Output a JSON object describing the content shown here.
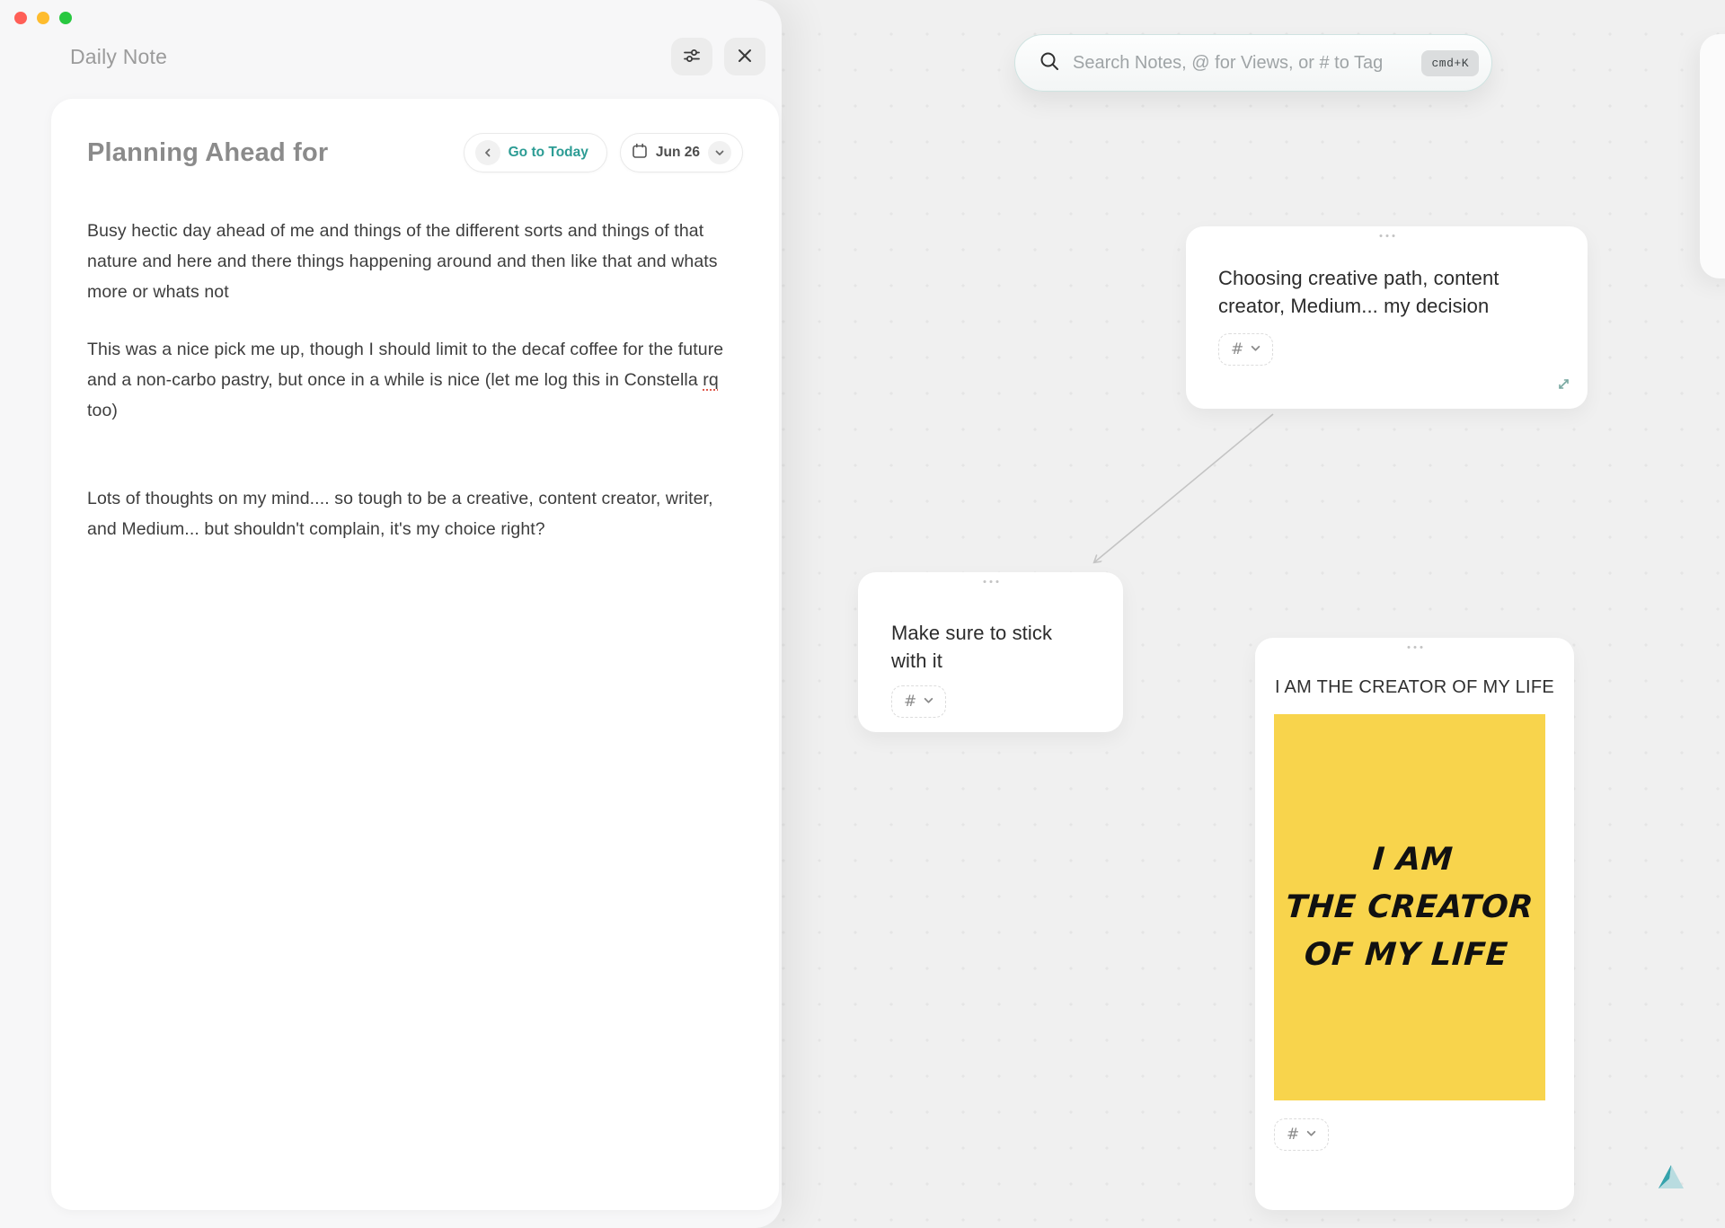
{
  "window": {
    "title": "Daily Note",
    "note": {
      "title": "Planning Ahead for",
      "nav": {
        "go_to_today": "Go to Today",
        "date": "Jun 26"
      },
      "paragraph_1": "Busy hectic day ahead of me and things of the different sorts and things of that nature and here and there things happening around and then like that and whats more or whats not",
      "paragraph_2_before": "This was a nice pick me up, though I should limit to the decaf coffee for the future and a non-carbo pastry, but once in a while is nice (let me log this in Constella ",
      "paragraph_2_misspelled": "rq",
      "paragraph_2_after": " too)",
      "paragraph_3": "Lots of thoughts on my mind.... so tough to be a creative, content creator, writer, and Medium... but shouldn't complain, it's my choice right?"
    }
  },
  "search": {
    "placeholder": "Search Notes, @ for Views, or # to Tag",
    "shortcut": "cmd+K"
  },
  "canvas": {
    "card_choosing": {
      "text": "Choosing creative path, content creator, Medium... my decision",
      "tag": "#"
    },
    "card_stick": {
      "text": "Make sure to stick with it",
      "tag": "#"
    },
    "card_creator": {
      "title": "I AM THE CREATOR OF MY LIFE",
      "poster": {
        "line_1": "I AM",
        "line_2": "THE CREATOR",
        "line_3": "OF MY LIFE"
      },
      "tag": "#"
    }
  },
  "icons": {
    "search": "magnifier",
    "settings": "sliders",
    "close": "x",
    "calendar": "calendar",
    "chevron_left": "‹",
    "chevron_down": "⌄",
    "expand": "diagonal-arrows",
    "drag_handle": "three-dots",
    "app_logo": "teal-triangle"
  },
  "colors": {
    "accent_teal": "#2c9c94",
    "poster_yellow": "#f8d44c",
    "canvas_bg": "#f0f0f0",
    "panel_bg": "#f7f7f8",
    "misspell_red": "#e05a4e"
  }
}
